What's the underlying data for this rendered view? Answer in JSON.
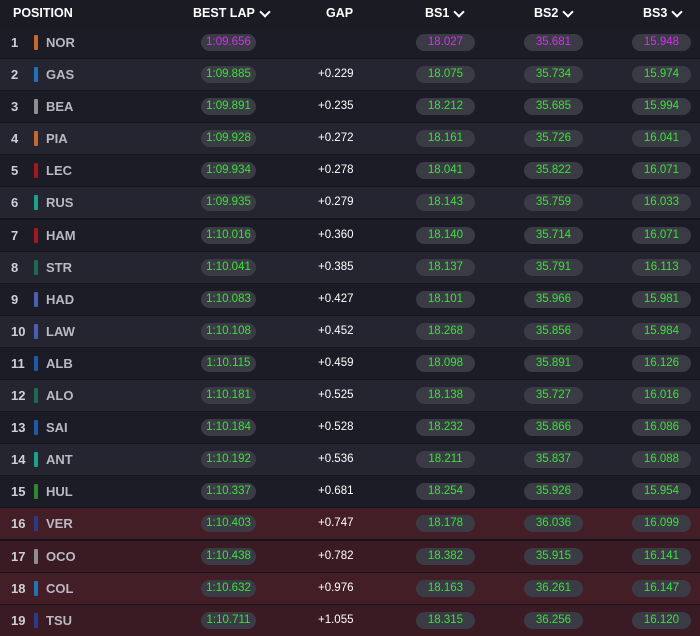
{
  "header": {
    "position": "POSITION",
    "best_lap": "BEST LAP",
    "gap": "GAP",
    "bs1": "BS1",
    "bs2": "BS2",
    "bs3": "BS3"
  },
  "colors": {
    "green_time": "#39e335",
    "purple_time": "#d42ef2",
    "elimination_zone": "#431e27"
  },
  "rows": [
    {
      "pos": "1",
      "driver": "NOR",
      "team_color": "#c8682b",
      "best_lap": "1:09.656",
      "lap_color": "purple",
      "gap": "",
      "bs1": "18.027",
      "bs1_color": "purple",
      "bs2": "35.681",
      "bs2_color": "purple",
      "bs3": "15.948",
      "bs3_color": "purple",
      "elim": false
    },
    {
      "pos": "2",
      "driver": "GAS",
      "team_color": "#2173b8",
      "best_lap": "1:09.885",
      "lap_color": "green",
      "gap": "+0.229",
      "bs1": "18.075",
      "bs1_color": "green",
      "bs2": "35.734",
      "bs2_color": "green",
      "bs3": "15.974",
      "bs3_color": "green",
      "elim": false
    },
    {
      "pos": "3",
      "driver": "BEA",
      "team_color": "#8d8d93",
      "best_lap": "1:09.891",
      "lap_color": "green",
      "gap": "+0.235",
      "bs1": "18.212",
      "bs1_color": "green",
      "bs2": "35.685",
      "bs2_color": "green",
      "bs3": "15.994",
      "bs3_color": "green",
      "elim": false
    },
    {
      "pos": "4",
      "driver": "PIA",
      "team_color": "#c8682b",
      "best_lap": "1:09.928",
      "lap_color": "green",
      "gap": "+0.272",
      "bs1": "18.161",
      "bs1_color": "green",
      "bs2": "35.726",
      "bs2_color": "green",
      "bs3": "16.041",
      "bs3_color": "green",
      "elim": false
    },
    {
      "pos": "5",
      "driver": "LEC",
      "team_color": "#a3181e",
      "best_lap": "1:09.934",
      "lap_color": "green",
      "gap": "+0.278",
      "bs1": "18.041",
      "bs1_color": "green",
      "bs2": "35.822",
      "bs2_color": "green",
      "bs3": "16.071",
      "bs3_color": "green",
      "elim": false
    },
    {
      "pos": "6",
      "driver": "RUS",
      "team_color": "#18a38c",
      "best_lap": "1:09.935",
      "lap_color": "green",
      "gap": "+0.279",
      "bs1": "18.143",
      "bs1_color": "green",
      "bs2": "35.759",
      "bs2_color": "green",
      "bs3": "16.033",
      "bs3_color": "green",
      "elim": false
    },
    {
      "pos": "7",
      "driver": "HAM",
      "team_color": "#a3181e",
      "best_lap": "1:10.016",
      "lap_color": "green",
      "gap": "+0.360",
      "bs1": "18.140",
      "bs1_color": "green",
      "bs2": "35.714",
      "bs2_color": "green",
      "bs3": "16.071",
      "bs3_color": "green",
      "elim": false
    },
    {
      "pos": "8",
      "driver": "STR",
      "team_color": "#1d6b4f",
      "best_lap": "1:10.041",
      "lap_color": "green",
      "gap": "+0.385",
      "bs1": "18.137",
      "bs1_color": "green",
      "bs2": "35.791",
      "bs2_color": "green",
      "bs3": "16.113",
      "bs3_color": "green",
      "elim": false
    },
    {
      "pos": "9",
      "driver": "HAD",
      "team_color": "#4a5fb0",
      "best_lap": "1:10.083",
      "lap_color": "green",
      "gap": "+0.427",
      "bs1": "18.101",
      "bs1_color": "green",
      "bs2": "35.966",
      "bs2_color": "green",
      "bs3": "15.981",
      "bs3_color": "green",
      "elim": false
    },
    {
      "pos": "10",
      "driver": "LAW",
      "team_color": "#4a5fb0",
      "best_lap": "1:10.108",
      "lap_color": "green",
      "gap": "+0.452",
      "bs1": "18.268",
      "bs1_color": "green",
      "bs2": "35.856",
      "bs2_color": "green",
      "bs3": "15.984",
      "bs3_color": "green",
      "elim": false
    },
    {
      "pos": "11",
      "driver": "ALB",
      "team_color": "#1f5aa6",
      "best_lap": "1:10.115",
      "lap_color": "green",
      "gap": "+0.459",
      "bs1": "18.098",
      "bs1_color": "green",
      "bs2": "35.891",
      "bs2_color": "green",
      "bs3": "16.126",
      "bs3_color": "green",
      "elim": false
    },
    {
      "pos": "12",
      "driver": "ALO",
      "team_color": "#1d6b4f",
      "best_lap": "1:10.181",
      "lap_color": "green",
      "gap": "+0.525",
      "bs1": "18.138",
      "bs1_color": "green",
      "bs2": "35.727",
      "bs2_color": "green",
      "bs3": "16.016",
      "bs3_color": "green",
      "elim": false
    },
    {
      "pos": "13",
      "driver": "SAI",
      "team_color": "#1f5aa6",
      "best_lap": "1:10.184",
      "lap_color": "green",
      "gap": "+0.528",
      "bs1": "18.232",
      "bs1_color": "green",
      "bs2": "35.866",
      "bs2_color": "green",
      "bs3": "16.086",
      "bs3_color": "green",
      "elim": false
    },
    {
      "pos": "14",
      "driver": "ANT",
      "team_color": "#18a38c",
      "best_lap": "1:10.192",
      "lap_color": "green",
      "gap": "+0.536",
      "bs1": "18.211",
      "bs1_color": "green",
      "bs2": "35.837",
      "bs2_color": "green",
      "bs3": "16.088",
      "bs3_color": "green",
      "elim": false
    },
    {
      "pos": "15",
      "driver": "HUL",
      "team_color": "#2f8a2f",
      "best_lap": "1:10.337",
      "lap_color": "green",
      "gap": "+0.681",
      "bs1": "18.254",
      "bs1_color": "green",
      "bs2": "35.926",
      "bs2_color": "green",
      "bs3": "15.954",
      "bs3_color": "green",
      "elim": false
    },
    {
      "pos": "16",
      "driver": "VER",
      "team_color": "#2b3a8c",
      "best_lap": "1:10.403",
      "lap_color": "green",
      "gap": "+0.747",
      "bs1": "18.178",
      "bs1_color": "green",
      "bs2": "36.036",
      "bs2_color": "green",
      "bs3": "16.099",
      "bs3_color": "green",
      "elim": true
    },
    {
      "pos": "17",
      "driver": "OCO",
      "team_color": "#8d8d93",
      "best_lap": "1:10.438",
      "lap_color": "green",
      "gap": "+0.782",
      "bs1": "18.382",
      "bs1_color": "green",
      "bs2": "35.915",
      "bs2_color": "green",
      "bs3": "16.141",
      "bs3_color": "green",
      "elim": true
    },
    {
      "pos": "18",
      "driver": "COL",
      "team_color": "#2173b8",
      "best_lap": "1:10.632",
      "lap_color": "green",
      "gap": "+0.976",
      "bs1": "18.163",
      "bs1_color": "green",
      "bs2": "36.261",
      "bs2_color": "green",
      "bs3": "16.147",
      "bs3_color": "green",
      "elim": true
    },
    {
      "pos": "19",
      "driver": "TSU",
      "team_color": "#2b3a8c",
      "best_lap": "1:10.711",
      "lap_color": "green",
      "gap": "+1.055",
      "bs1": "18.315",
      "bs1_color": "green",
      "bs2": "36.256",
      "bs2_color": "green",
      "bs3": "16.120",
      "bs3_color": "green",
      "elim": true
    }
  ]
}
